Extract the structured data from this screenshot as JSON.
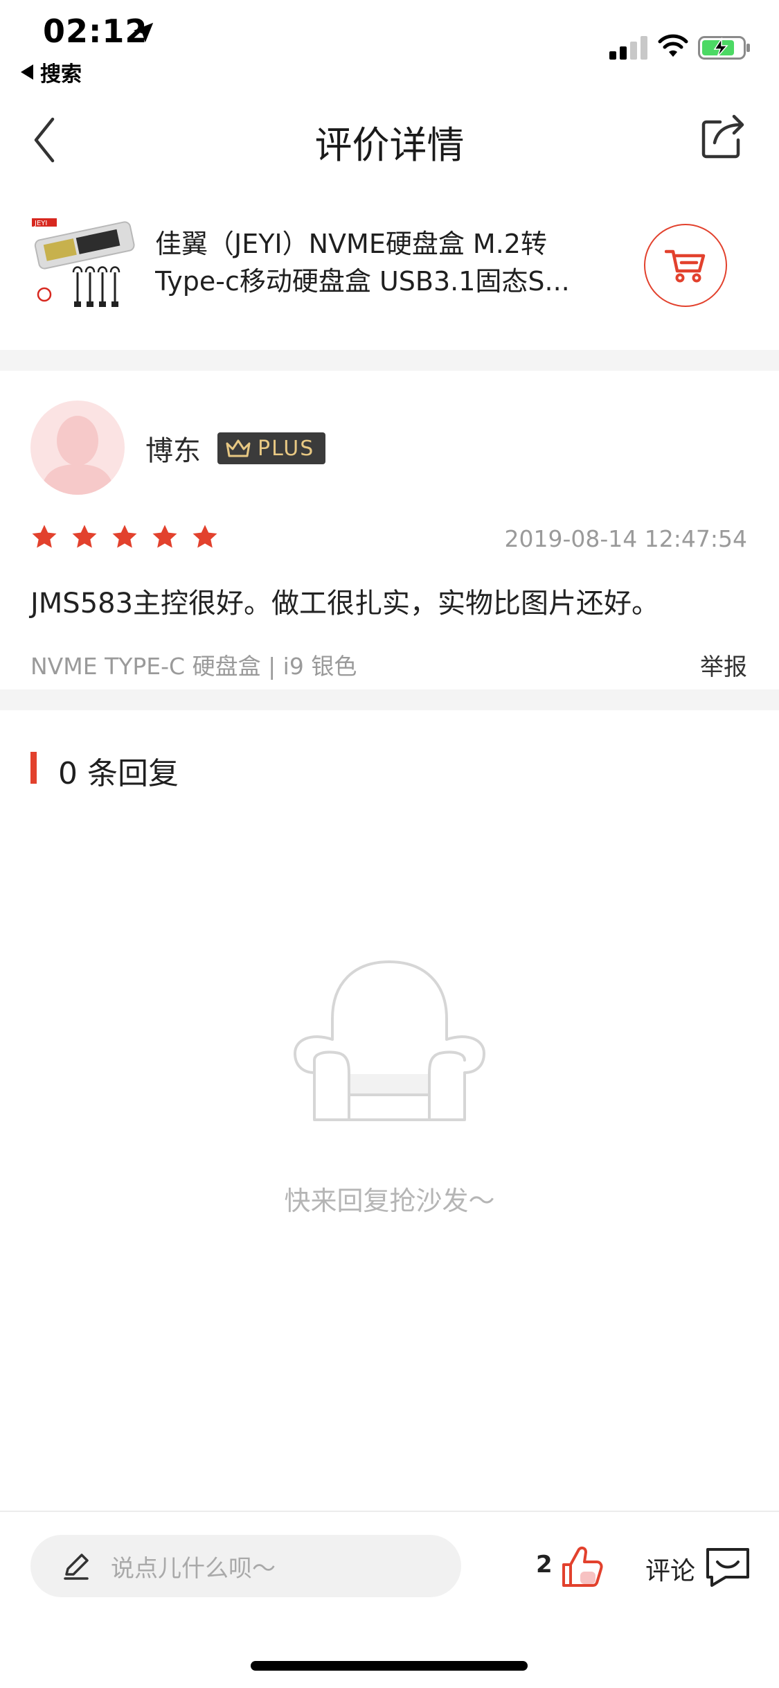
{
  "status_bar": {
    "time": "02:12",
    "back_app_label": "搜索"
  },
  "nav": {
    "title": "评价详情"
  },
  "product": {
    "title_line1": "佳翼（JEYI）NVME硬盘盒 M.2转",
    "title_line2": "Type-c移动硬盘盒 USB3.1固态S...",
    "thumb_brand": "JEYI"
  },
  "review": {
    "reviewer_name": "博东",
    "badge_label": "PLUS",
    "rating": 5,
    "date": "2019-08-14 12:47:54",
    "text": "JMS583主控很好。做工很扎实，实物比图片还好。",
    "spec": "NVME TYPE-C 硬盘盒 | i9 银色",
    "report_label": "举报"
  },
  "replies": {
    "count_label": "0 条回复",
    "empty_text": "快来回复抢沙发～"
  },
  "bottom_bar": {
    "input_placeholder": "说点儿什么呗～",
    "like_count": "2",
    "comment_label": "评论"
  },
  "colors": {
    "accent": "#e2412d",
    "muted_text": "#9a9a9a",
    "band": "#f4f4f4"
  }
}
